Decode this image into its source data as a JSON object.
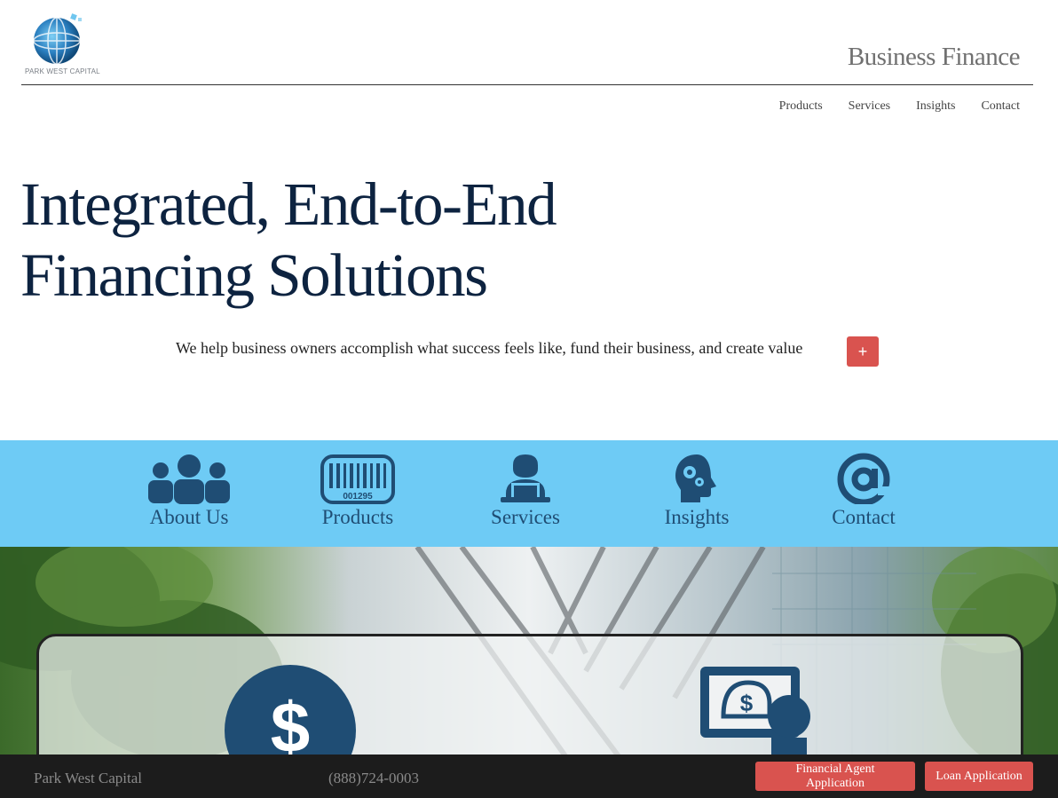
{
  "header": {
    "logo_text": "PARK WEST CAPITAL",
    "brand_title": "Business Finance",
    "nav": [
      "Products",
      "Services",
      "Insights",
      "Contact"
    ]
  },
  "hero": {
    "heading_line1": "Integrated, End-to-End",
    "heading_line2": "Financing Solutions",
    "tagline": "We help business owners accomplish what success feels like, fund their business, and create value",
    "plus_label": "+"
  },
  "band": {
    "items": [
      {
        "label": "About Us",
        "icon": "people-icon"
      },
      {
        "label": "Products",
        "icon": "barcode-icon",
        "icon_code": "001295"
      },
      {
        "label": "Services",
        "icon": "person-laptop-icon"
      },
      {
        "label": "Insights",
        "icon": "head-gears-icon"
      },
      {
        "label": "Contact",
        "icon": "at-sign-icon"
      }
    ]
  },
  "panel": {
    "icons": [
      "dollar-circle-icon",
      "advisor-monitor-icon"
    ]
  },
  "footer": {
    "brand": "Park West Capital",
    "phone": "(888)724-0003",
    "buttons": [
      "Financial Agent Application",
      "Loan Application"
    ]
  },
  "colors": {
    "accent_red": "#d9534f",
    "band_blue": "#6ecbf5",
    "icon_navy": "#1f4d74",
    "heading_navy": "#0d2340",
    "footer_bg": "#1c1c1c"
  }
}
